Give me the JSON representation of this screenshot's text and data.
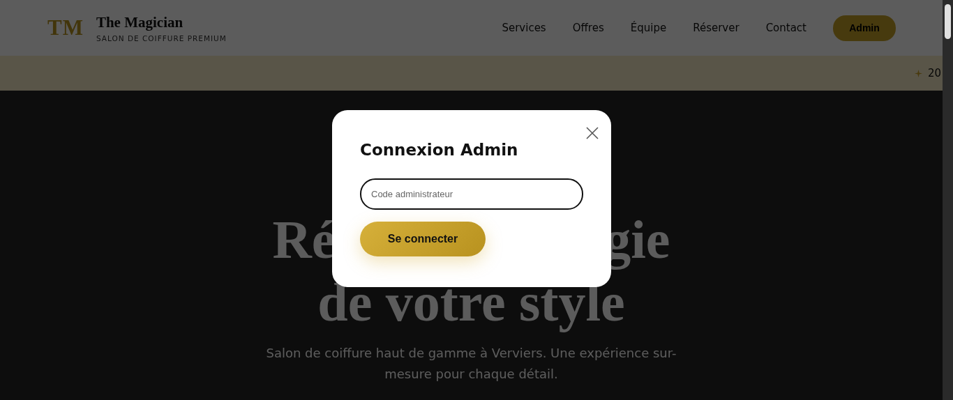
{
  "header": {
    "logo": "TM",
    "title": "The Magician",
    "subtitle": "SALON DE COIFFURE PREMIUM",
    "nav": [
      {
        "label": "Services"
      },
      {
        "label": "Offres"
      },
      {
        "label": "Équipe"
      },
      {
        "label": "Réserver"
      },
      {
        "label": "Contact"
      }
    ],
    "admin_button": "Admin"
  },
  "ticker": {
    "text": "20"
  },
  "hero": {
    "title_line_1": [
      "Ré",
      "gie"
    ],
    "title_line_2": "de votre style",
    "subtitle": "Salon de coiffure haut de gamme à Verviers. Une expérience sur-mesure pour chaque détail."
  },
  "modal": {
    "title": "Connexion Admin",
    "input": {
      "placeholder": "Code administrateur"
    },
    "submit": "Se connecter"
  }
}
